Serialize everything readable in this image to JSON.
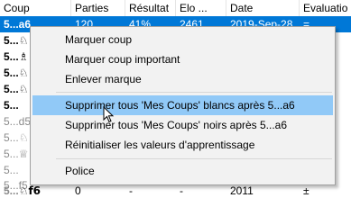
{
  "columns": [
    "Coup",
    "Parties",
    "Résultat",
    "Elo ...",
    "Date",
    "Evaluatio"
  ],
  "selected_row": {
    "move": "5...a6",
    "games": "120",
    "result": "41%",
    "elo": "2461",
    "date": "2019-Sep-28",
    "eval": "="
  },
  "left_moves": [
    {
      "text": "5...",
      "piece": "♘"
    },
    {
      "text": "5...",
      "piece": "♗"
    },
    {
      "text": "5...",
      "piece": "♘"
    },
    {
      "text": "5...",
      "piece": "♘"
    },
    {
      "text": "5...",
      "piece": ""
    },
    {
      "text": "5...d5",
      "piece": ""
    },
    {
      "text": "5...",
      "piece": "♘"
    },
    {
      "text": "5...",
      "piece": "♕"
    },
    {
      "text": "5...",
      "piece": ""
    },
    {
      "text": "5...f5",
      "piece": ""
    }
  ],
  "last_row": {
    "move": "♘f6",
    "prefix": "5...",
    "games": "0",
    "result": "-",
    "elo": "-",
    "date": "2011",
    "eval": "±"
  },
  "menu": {
    "items": [
      {
        "label": "Marquer coup"
      },
      {
        "label": "Marquer coup important"
      },
      {
        "label": "Enlever marque"
      },
      {
        "label": "Supprimer tous 'Mes Coups' blancs après 5...a6"
      },
      {
        "label": "Supprimer tous 'Mes Coups' noirs après 5...a6"
      },
      {
        "label": "Réinitialiser les valeurs d'apprentissage"
      },
      {
        "label": "Police"
      }
    ]
  },
  "colors": {
    "selection": "#0078d7",
    "menu_hover": "#91c9f7",
    "menu_bg": "#f2f2f2"
  }
}
